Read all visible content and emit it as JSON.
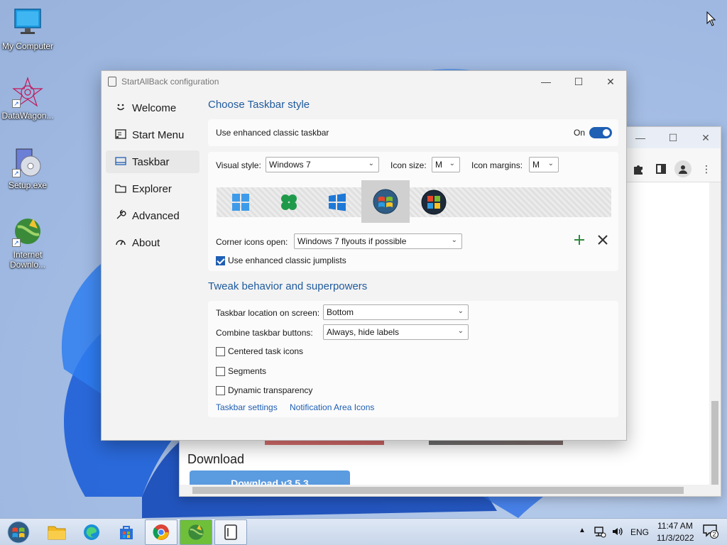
{
  "desktop": {
    "icons": [
      {
        "label": "My Computer"
      },
      {
        "label": "DataWagon..."
      },
      {
        "label": "Setup.exe"
      },
      {
        "label": "Internet Downlo..."
      }
    ]
  },
  "browser": {
    "download_heading": "Download",
    "download_button": "Download v3.5.3"
  },
  "config": {
    "title": "StartAllBack configuration",
    "nav": [
      {
        "label": "Welcome",
        "icon": "smile-icon"
      },
      {
        "label": "Start Menu",
        "icon": "start-menu-icon"
      },
      {
        "label": "Taskbar",
        "icon": "taskbar-icon"
      },
      {
        "label": "Explorer",
        "icon": "folder-icon"
      },
      {
        "label": "Advanced",
        "icon": "wrench-icon"
      },
      {
        "label": "About",
        "icon": "gauge-icon"
      }
    ],
    "active_nav": "Taskbar",
    "section1_title": "Choose Taskbar style",
    "enhanced_label": "Use enhanced classic taskbar",
    "enhanced_state": "On",
    "visual_style_label": "Visual style:",
    "visual_style_value": "Windows 7",
    "icon_size_label": "Icon size:",
    "icon_size_value": "M",
    "icon_margins_label": "Icon margins:",
    "icon_margins_value": "M",
    "corner_icons_label": "Corner icons open:",
    "corner_icons_value": "Windows 7 flyouts if possible",
    "jumplists_label": "Use enhanced classic jumplists",
    "jumplists_checked": true,
    "section2_title": "Tweak behavior and superpowers",
    "location_label": "Taskbar location on screen:",
    "location_value": "Bottom",
    "combine_label": "Combine taskbar buttons:",
    "combine_value": "Always, hide labels",
    "centered_label": "Centered task icons",
    "segments_label": "Segments",
    "dynamic_label": "Dynamic transparency",
    "link_taskbar_settings": "Taskbar settings",
    "link_notification_icons": "Notification Area Icons"
  },
  "taskbar": {
    "language": "ENG",
    "time": "11:47 AM",
    "date": "11/3/2022",
    "notification_count": "2"
  },
  "colors": {
    "accent": "#1f5fb4",
    "section_title": "#1f5a9e",
    "add_green": "#2e8b3a"
  }
}
